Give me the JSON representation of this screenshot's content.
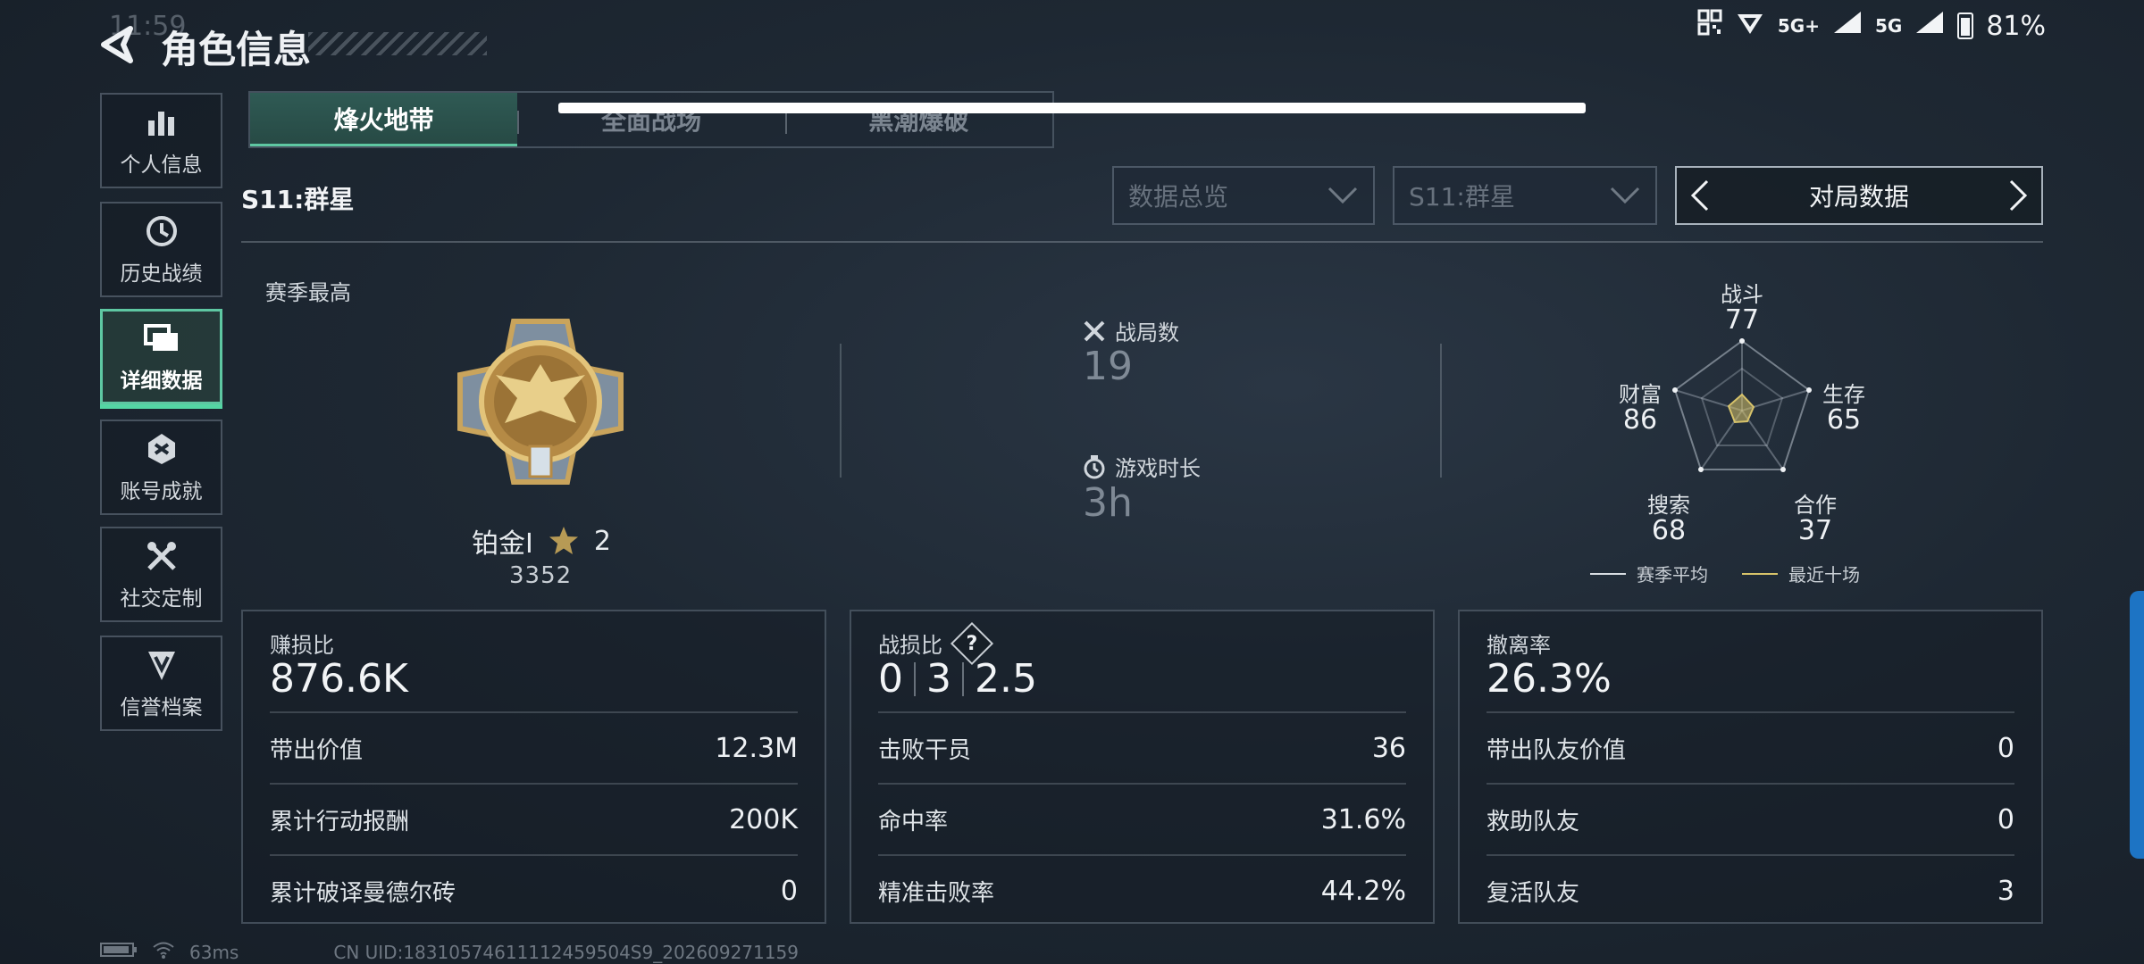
{
  "status_bar": {
    "time": "11:59",
    "network_1": "5G+",
    "network_2": "5G",
    "battery": "81%"
  },
  "header": {
    "title": "角色信息"
  },
  "sidebar": {
    "items": [
      {
        "label": "个人信息",
        "icon": "bar-chart-icon"
      },
      {
        "label": "历史战绩",
        "icon": "history-icon"
      },
      {
        "label": "详细数据",
        "icon": "folder-icon",
        "active": true
      },
      {
        "label": "账号成就",
        "icon": "medal-icon"
      },
      {
        "label": "社交定制",
        "icon": "tools-icon"
      },
      {
        "label": "信誉档案",
        "icon": "shield-icon"
      }
    ]
  },
  "tabs": [
    {
      "label": "烽火地带",
      "active": true
    },
    {
      "label": "全面战场"
    },
    {
      "label": "黑潮爆破"
    }
  ],
  "season_label": "S11:群星",
  "filters": {
    "overview": "数据总览",
    "season": "S11:群星",
    "mode": "对局数据"
  },
  "profile": {
    "season_best_label": "赛季最高",
    "rank_name": "铂金I",
    "rank_stars": "2",
    "rank_points": "3352"
  },
  "summary": {
    "matches_label": "战局数",
    "matches_value": "19",
    "playtime_label": "游戏时长",
    "playtime_value": "3h"
  },
  "radar": {
    "axes": [
      {
        "label": "战斗",
        "value": "77"
      },
      {
        "label": "生存",
        "value": "65"
      },
      {
        "label": "合作",
        "value": "37"
      },
      {
        "label": "搜索",
        "value": "68"
      },
      {
        "label": "财富",
        "value": "86"
      }
    ],
    "legend": [
      {
        "label": "赛季平均",
        "color": "#d8dde2"
      },
      {
        "label": "最近十场",
        "color": "#d7c36a"
      }
    ]
  },
  "cards": [
    {
      "title": "赚损比",
      "value": "876.6K",
      "rows": [
        {
          "label": "带出价值",
          "value": "12.3M"
        },
        {
          "label": "累计行动报酬",
          "value": "200K"
        },
        {
          "label": "累计破译曼德尔砖",
          "value": "0"
        }
      ]
    },
    {
      "title": "战损比",
      "kd": [
        "0",
        "3",
        "2.5"
      ],
      "rows": [
        {
          "label": "击败干员",
          "value": "36"
        },
        {
          "label": "命中率",
          "value": "31.6%"
        },
        {
          "label": "精准击败率",
          "value": "44.2%"
        }
      ]
    },
    {
      "title": "撤离率",
      "value": "26.3%",
      "rows": [
        {
          "label": "带出队友价值",
          "value": "0"
        },
        {
          "label": "救助队友",
          "value": "0"
        },
        {
          "label": "复活队友",
          "value": "3"
        }
      ]
    }
  ],
  "footer": {
    "ping": "63ms",
    "uid": "CN UID:18310574611112459504S9_202609271159"
  },
  "colors": {
    "accent": "#5ec7a2",
    "gold": "#d7c36a"
  }
}
